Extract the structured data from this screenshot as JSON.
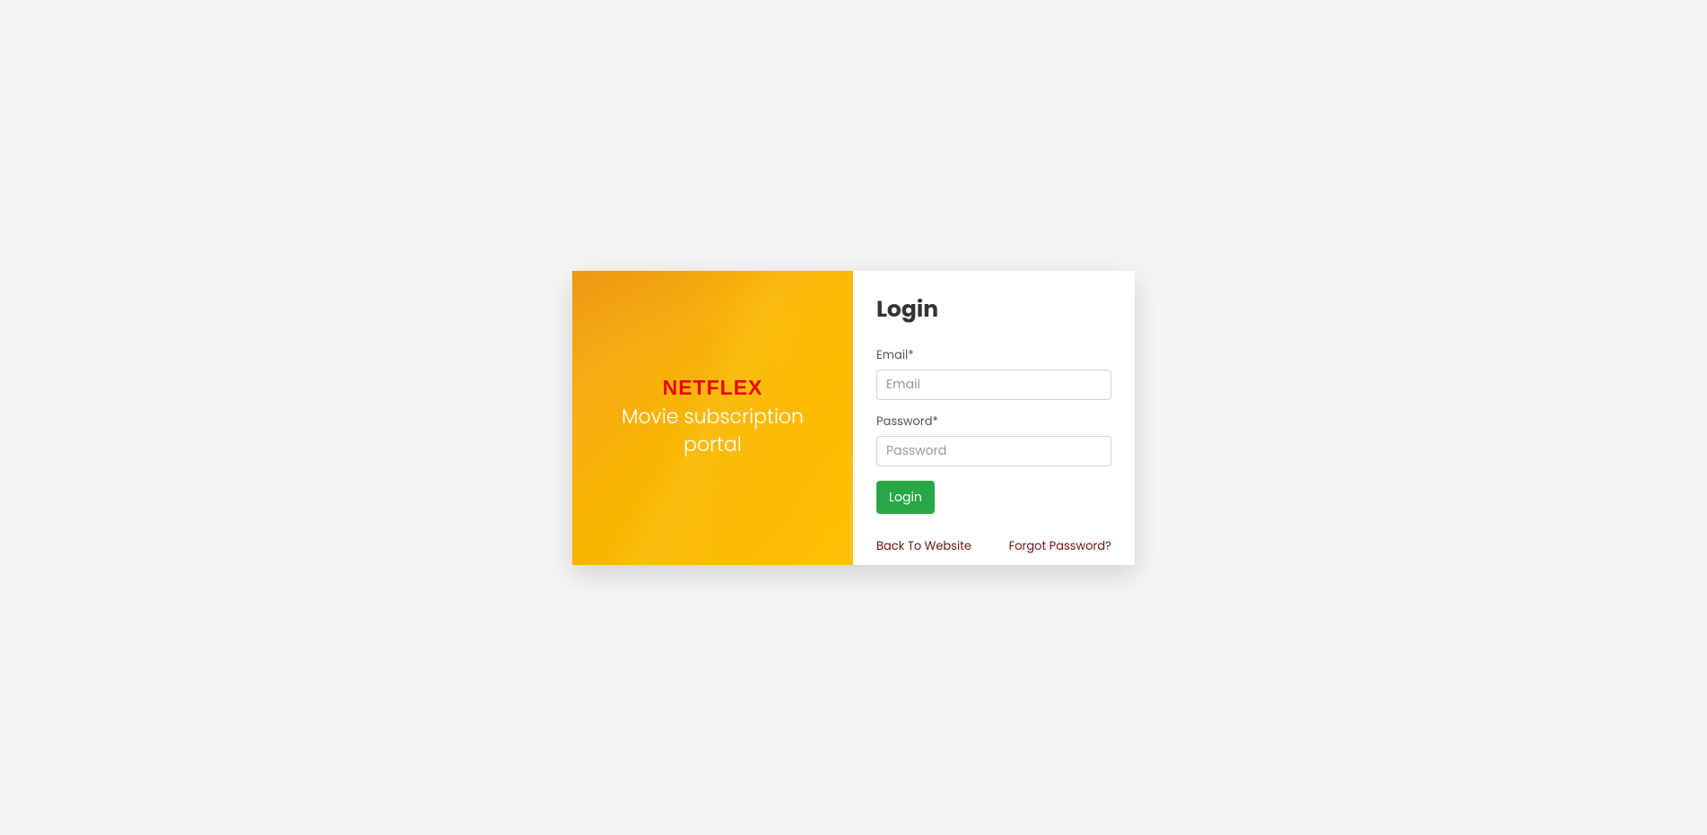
{
  "brand": {
    "name": "NETFLEX",
    "tagline": "Movie subscription portal"
  },
  "form": {
    "title": "Login",
    "email_label": "Email*",
    "email_placeholder": "Email",
    "password_label": "Password*",
    "password_placeholder": "Password",
    "submit_label": "Login"
  },
  "links": {
    "back": "Back To Website",
    "forgot": "Forgot Password?"
  }
}
